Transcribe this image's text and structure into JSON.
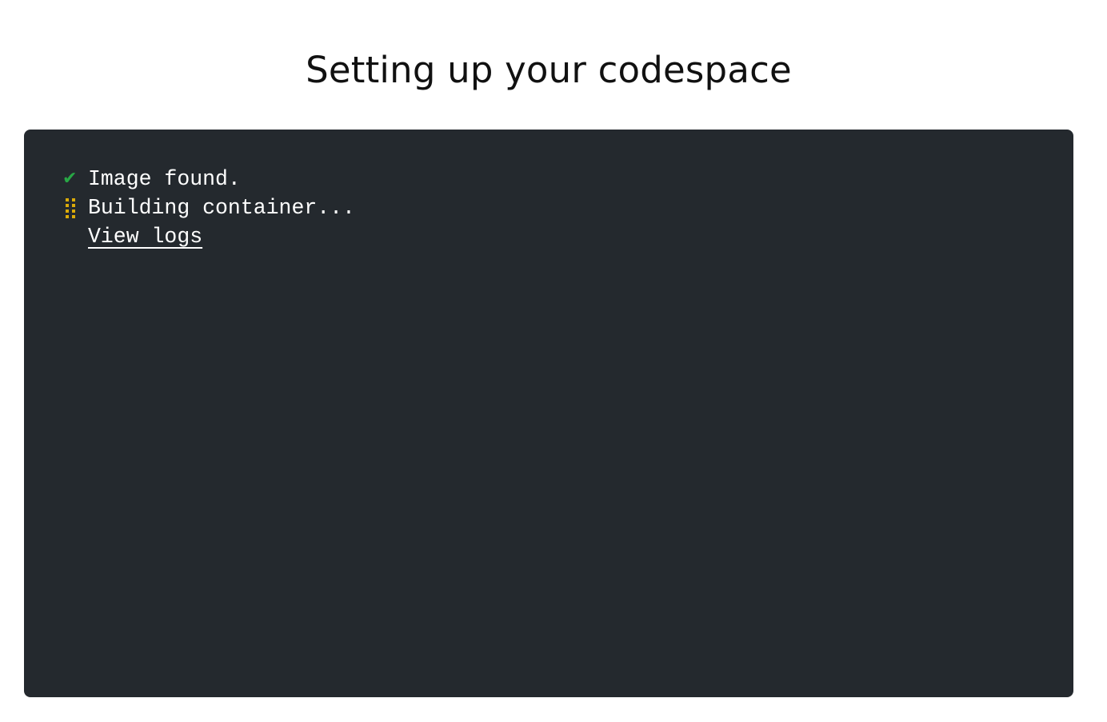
{
  "page": {
    "title": "Setting up your codespace"
  },
  "terminal": {
    "background": "#24292e",
    "lines": [
      {
        "status": "done",
        "icon": "check-icon",
        "icon_glyph": "✔",
        "icon_color": "#28a745",
        "text": "Image found."
      },
      {
        "status": "in-progress",
        "icon": "spinner-icon",
        "icon_color": "#dbab09",
        "text": "Building container..."
      }
    ],
    "view_logs_label": "View logs"
  }
}
